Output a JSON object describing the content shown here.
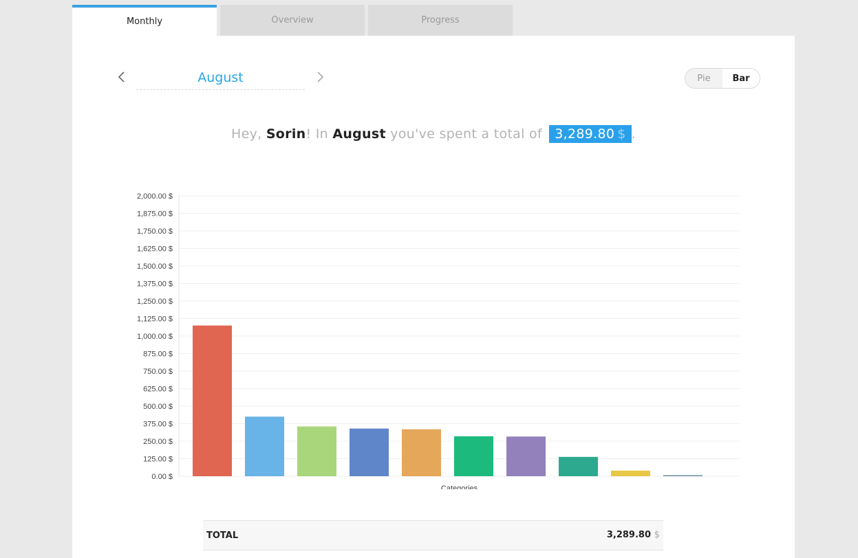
{
  "tabs": [
    {
      "label": "Monthly",
      "active": true
    },
    {
      "label": "Overview",
      "active": false
    },
    {
      "label": "Progress",
      "active": false
    }
  ],
  "month_nav": {
    "month": "August",
    "prev_icon": "chevron-left-icon",
    "next_icon": "chevron-right-icon"
  },
  "view_toggle": {
    "pie_label": "Pie",
    "bar_label": "Bar",
    "selected": "Bar"
  },
  "summary": {
    "greeting": "Hey,",
    "name": "Sorin",
    "in_text": "! In",
    "month": "August",
    "spent_text": "you've spent a total of",
    "amount": "3,289.80",
    "currency": "$",
    "end": "."
  },
  "chart_data": {
    "type": "bar",
    "xlabel": "Categories",
    "ylabel": "",
    "ylim": [
      0,
      2000
    ],
    "y_ticks": [
      "0.00 $",
      "125.00 $",
      "250.00 $",
      "375.00 $",
      "500.00 $",
      "625.00 $",
      "750.00 $",
      "875.00 $",
      "1,000.00 $",
      "1,125.00 $",
      "1,250.00 $",
      "1,375.00 $",
      "1,500.00 $",
      "1,625.00 $",
      "1,750.00 $",
      "1,875.00 $",
      "2,000.00 $"
    ],
    "values": [
      1075,
      425,
      355,
      340,
      335,
      285,
      283,
      138,
      40,
      5
    ],
    "colors": [
      "#e06651",
      "#68b3e8",
      "#a9d67b",
      "#5e86c8",
      "#e5a75a",
      "#1cba7c",
      "#9281bb",
      "#2da990",
      "#e9c746",
      "#6a8fa6"
    ],
    "grid": true
  },
  "total": {
    "label": "TOTAL",
    "value": "3,289.80",
    "currency": "$"
  }
}
